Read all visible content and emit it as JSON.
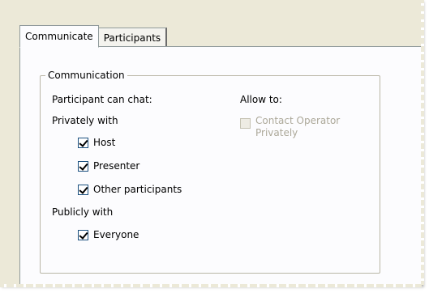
{
  "tabs": [
    {
      "label": "Communicate",
      "active": true
    },
    {
      "label": "Participants",
      "active": false
    }
  ],
  "group": {
    "title": "Communication"
  },
  "left": {
    "can_chat_label": "Participant can chat:",
    "privately_label": "Privately with",
    "private_options": [
      {
        "label": "Host",
        "checked": true
      },
      {
        "label": "Presenter",
        "checked": true
      },
      {
        "label": "Other participants",
        "checked": true
      }
    ],
    "publicly_label": "Publicly with",
    "public_options": [
      {
        "label": "Everyone",
        "checked": true
      }
    ]
  },
  "right": {
    "allow_label": "Allow to:",
    "contact_operator": {
      "label_line1": "Contact Operator",
      "label_line2": "Privately",
      "checked": false,
      "enabled": false
    }
  }
}
